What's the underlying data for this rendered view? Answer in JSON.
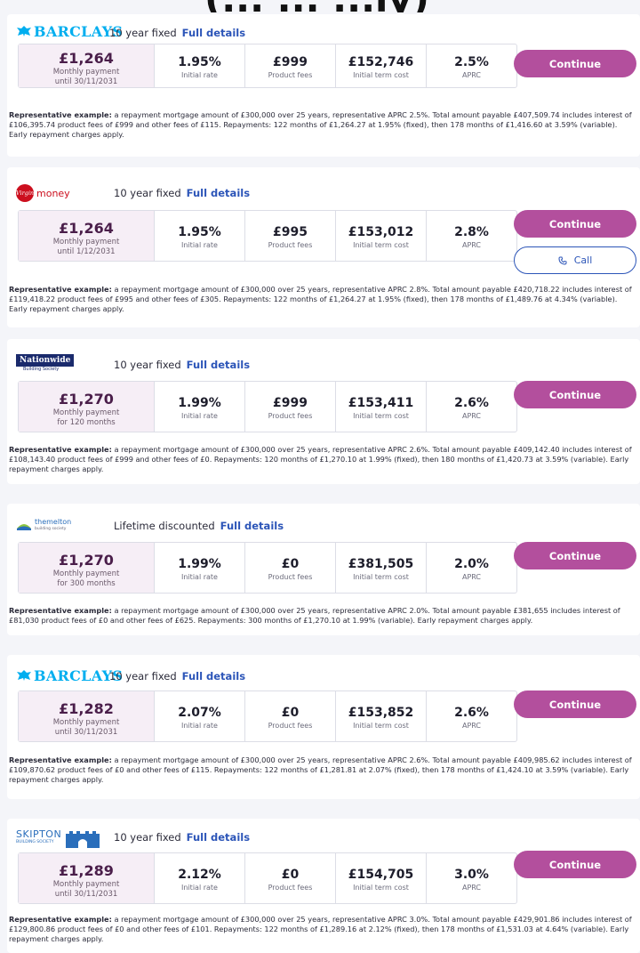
{
  "page": {
    "header_fragment": "(... ... ...ly)"
  },
  "common": {
    "continue_label": "Continue",
    "call_label": "Call",
    "details_label": "Full details",
    "rep_label": "Representative example:",
    "labels": {
      "initial_rate": "Initial rate",
      "product_fees": "Product fees",
      "initial_term_cost": "Initial term cost",
      "aprc": "APRC"
    }
  },
  "deals": [
    {
      "lender": "BARCLAYS",
      "product_type": "10 year fixed",
      "monthly": "£1,264",
      "monthly_label_1": "Monthly payment",
      "monthly_label_2": "until 30/11/2031",
      "initial_rate": "1.95%",
      "product_fees": "£999",
      "initial_term_cost": "£152,746",
      "aprc": "2.5%",
      "representative": "a repayment mortgage amount of £300,000 over 25 years, representative APRC 2.5%. Total amount payable £407,509.74 includes interest of £106,395.74 product fees of £999 and other fees of £115. Repayments: 122 months of £1,264.27 at 1.95% (fixed), then 178 months of £1,416.60 at 3.59% (variable). Early repayment charges apply."
    },
    {
      "lender": "money",
      "lender_mark": "Virgin",
      "product_type": "10 year fixed",
      "monthly": "£1,264",
      "monthly_label_1": "Monthly payment",
      "monthly_label_2": "until 1/12/2031",
      "initial_rate": "1.95%",
      "product_fees": "£995",
      "initial_term_cost": "£153,012",
      "aprc": "2.8%",
      "representative": "a repayment mortgage amount of £300,000 over 25 years, representative APRC 2.8%. Total amount payable £420,718.22 includes interest of £119,418.22 product fees of £995 and other fees of £305. Repayments: 122 months of £1,264.27 at 1.95% (fixed), then 178 months of £1,489.76 at 4.34% (variable). Early repayment charges apply."
    },
    {
      "lender": "Nationwide",
      "lender_sub": "Building Society",
      "product_type": "10 year fixed",
      "monthly": "£1,270",
      "monthly_label_1": "Monthly payment",
      "monthly_label_2": "for 120 months",
      "initial_rate": "1.99%",
      "product_fees": "£999",
      "initial_term_cost": "£153,411",
      "aprc": "2.6%",
      "representative": "a repayment mortgage amount of £300,000 over 25 years, representative APRC 2.6%. Total amount payable £409,142.40 includes interest of £108,143.40 product fees of £999 and other fees of £0. Repayments: 120 months of £1,270.10 at 1.99% (fixed), then 180 months of £1,420.73 at 3.59% (variable). Early repayment charges apply."
    },
    {
      "lender": "themelton",
      "lender_sub": "building society",
      "product_type": "Lifetime discounted",
      "monthly": "£1,270",
      "monthly_label_1": "Monthly payment",
      "monthly_label_2": "for 300 months",
      "initial_rate": "1.99%",
      "product_fees": "£0",
      "initial_term_cost": "£381,505",
      "aprc": "2.0%",
      "representative": "a repayment mortgage amount of £300,000 over 25 years, representative APRC 2.0%. Total amount payable £381,655 includes interest of £81,030 product fees of £0 and other fees of £625. Repayments: 300 months of £1,270.10 at 1.99% (variable). Early repayment charges apply."
    },
    {
      "lender": "BARCLAYS",
      "product_type": "10 year fixed",
      "monthly": "£1,282",
      "monthly_label_1": "Monthly payment",
      "monthly_label_2": "until 30/11/2031",
      "initial_rate": "2.07%",
      "product_fees": "£0",
      "initial_term_cost": "£153,852",
      "aprc": "2.6%",
      "representative": "a repayment mortgage amount of £300,000 over 25 years, representative APRC 2.6%. Total amount payable £409,985.62 includes interest of £109,870.62 product fees of £0 and other fees of £115. Repayments: 122 months of £1,281.81 at 2.07% (fixed), then 178 months of £1,424.10 at 3.59% (variable). Early repayment charges apply."
    },
    {
      "lender": "SKIPTON",
      "lender_sub": "BUILDING SOCIETY",
      "product_type": "10 year fixed",
      "monthly": "£1,289",
      "monthly_label_1": "Monthly payment",
      "monthly_label_2": "until 30/11/2031",
      "initial_rate": "2.12%",
      "product_fees": "£0",
      "initial_term_cost": "£154,705",
      "aprc": "3.0%",
      "representative": "a repayment mortgage amount of £300,000 over 25 years, representative APRC 3.0%. Total amount payable £429,901.86 includes interest of £129,800.86 product fees of £0 and other fees of £101. Repayments: 122 months of £1,289.16 at 2.12% (fixed), then 178 months of £1,531.03 at 4.64% (variable). Early repayment charges apply."
    }
  ],
  "colors": {
    "brand_purple": "#b34f9d",
    "link_blue": "#2c55b8",
    "barclays_blue": "#00aeef",
    "virgin_red": "#cc0f1e",
    "nationwide_navy": "#1a2a6c",
    "skipton_blue": "#2a6ebb"
  }
}
